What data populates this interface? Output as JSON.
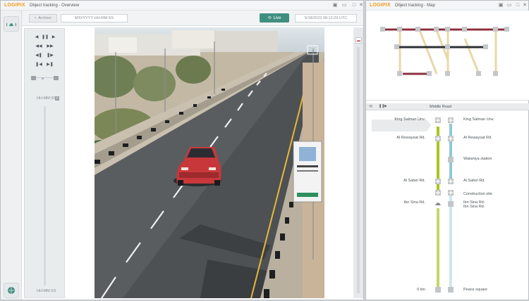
{
  "left_window": {
    "logo": "LOGIPIX",
    "title": "Object tracking - Overview",
    "toolbar": {
      "archive_label": "Archive",
      "date_placeholder": "M/D/YYYY HH:MM:SS",
      "live_label": "Live",
      "timestamp": "5/18/2023 08:12:29 UTC"
    },
    "panel": {
      "time_top": "HH:MM:SS",
      "time_bottom": "HH:MM:SS"
    }
  },
  "right_window": {
    "logo": "LOGIPIX",
    "title": "Object tracking - Map",
    "route": {
      "title": "Middle Road",
      "left_stops": [
        "King Salman Unv.",
        "Al Rewaysat Rd.",
        "Al Safari Rd.",
        "Ibn Sina Rd.",
        "0 km"
      ],
      "right_stops": [
        "King Salman Unv.",
        "Al Rewaysat Rd.",
        "Wataniya station",
        "Al Safari Rd.",
        "Construction site",
        "Ibn Sina Rd.",
        "Ibn Sina Rd.",
        "Peace square"
      ]
    }
  },
  "colors": {
    "accent_live": "#3f8f7f",
    "line_green": "#a9c41d",
    "line_blue": "#8fc9d8",
    "line_tan": "#ead7a8",
    "line_maroon": "#8c3040"
  }
}
